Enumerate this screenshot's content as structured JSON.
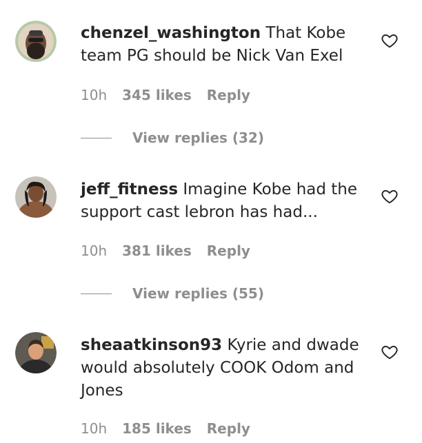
{
  "comments": [
    {
      "username": "chenzel_washington",
      "text": "That Kobe team PG should be Nick Van Exel",
      "time": "10h",
      "likes": "345 likes",
      "reply_label": "Reply",
      "view_replies": "View replies (32)",
      "avatar_icon": "avatar-bearded-man-sunglasses",
      "like_icon": "heart-outline-icon"
    },
    {
      "username": "jeff_fitness",
      "text": "Imagine Kobe had the support cast lebron has had...",
      "time": "10h",
      "likes": "381 likes",
      "reply_label": "Reply",
      "view_replies": "View replies (55)",
      "avatar_icon": "avatar-shirtless-man",
      "like_icon": "heart-outline-icon"
    },
    {
      "username": "sheaatkinson93",
      "text": "Kyrie and dwade would absolutely COOK Odom and Jones",
      "time": "10h",
      "likes": "185 likes",
      "reply_label": "Reply",
      "avatar_icon": "avatar-man-portrait",
      "like_icon": "heart-outline-icon"
    }
  ],
  "colors": {
    "text": "#262626",
    "secondary": "#8e8e8e",
    "background": "#ffffff"
  }
}
